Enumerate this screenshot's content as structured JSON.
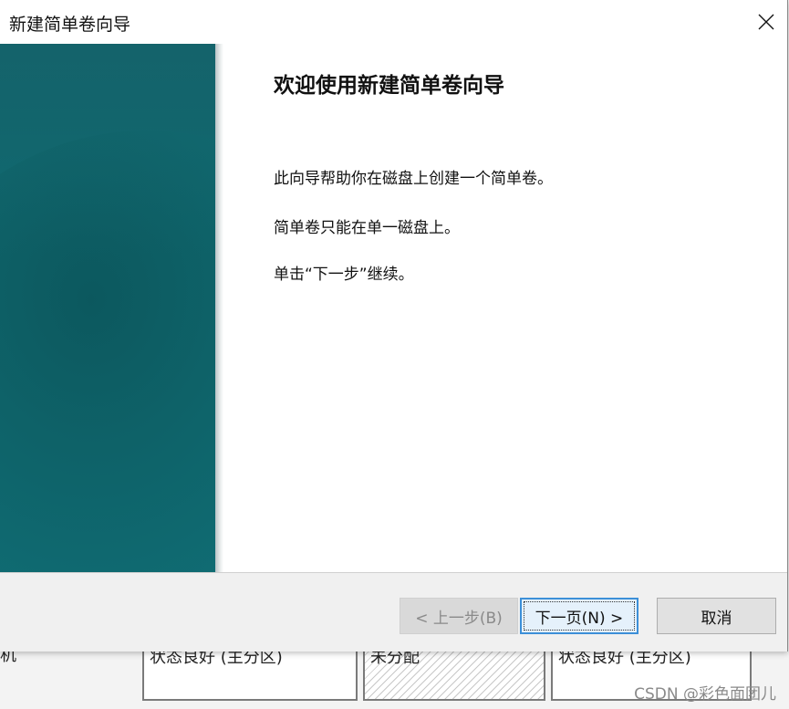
{
  "window": {
    "title": "新建简单卷向导"
  },
  "page": {
    "heading": "欢迎使用新建简单卷向导",
    "paragraphs": [
      "此向导帮助你在磁盘上创建一个简单卷。",
      "简单卷只能在单一磁盘上。",
      "单击“下一步”继续。"
    ]
  },
  "buttons": {
    "back": "< 上一步(B)",
    "next": "下一页(N) >",
    "cancel": "取消"
  },
  "background": {
    "left_fragment": "机",
    "cells": [
      "状态良好 (主分区)",
      "未分配",
      "状态良好 (主分区)"
    ]
  },
  "watermark": "CSDN @彩色面团儿",
  "icons": {
    "close": "close-icon"
  },
  "colors": {
    "banner": "#0f6a70",
    "accent": "#3c8fd8"
  }
}
